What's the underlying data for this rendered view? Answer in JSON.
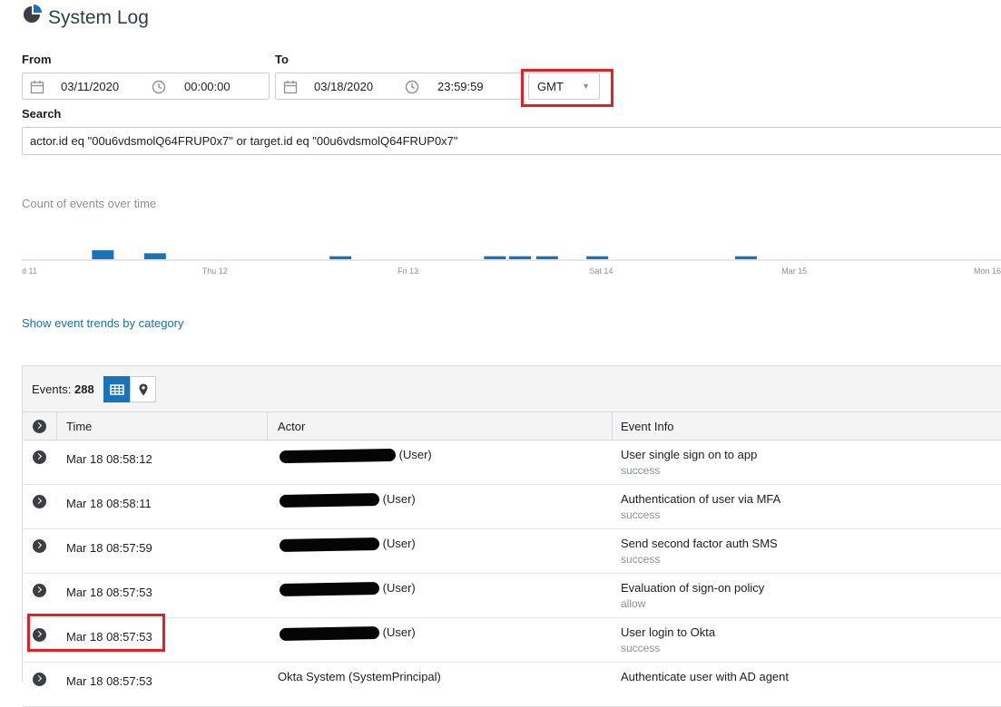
{
  "header": {
    "title": "System Log"
  },
  "filters": {
    "from_label": "From",
    "to_label": "To",
    "from_date": "03/11/2020",
    "from_time": "00:00:00",
    "to_date": "03/18/2020",
    "to_time": "23:59:59",
    "timezone": "GMT",
    "search_label": "Search",
    "search_value": "actor.id eq \"00u6vdsmolQ64FRUP0x7\" or target.id eq \"00u6vdsmolQ64FRUP0x7\""
  },
  "chart_data": {
    "type": "bar",
    "title": "Count of events over time",
    "xlabel": "",
    "ylabel": "",
    "tick_labels": [
      "d 11",
      "Thu 12",
      "Fri 13",
      "Sat 14",
      "Mar 15",
      "Mon 16"
    ],
    "x_range_days": [
      0,
      5
    ],
    "bars": [
      {
        "x": 0.42,
        "value": 3
      },
      {
        "x": 0.69,
        "value": 2
      },
      {
        "x": 1.65,
        "value": 1
      },
      {
        "x": 2.45,
        "value": 1
      },
      {
        "x": 2.58,
        "value": 1
      },
      {
        "x": 2.72,
        "value": 1
      },
      {
        "x": 2.98,
        "value": 1
      },
      {
        "x": 3.75,
        "value": 1
      }
    ],
    "grid": false,
    "bar_color": "#1a72b8"
  },
  "trends_link": "Show event trends by category",
  "table": {
    "events_label": "Events:",
    "events_count": "288",
    "columns": [
      "Time",
      "Actor",
      "Event Info"
    ],
    "rows": [
      {
        "time": "Mar 18 08:58:12",
        "actor_suffix": "(User)",
        "event": "User single sign on to app",
        "outcome": "success"
      },
      {
        "time": "Mar 18 08:58:11",
        "actor_suffix": "(User)",
        "event": "Authentication of user via MFA",
        "outcome": "success"
      },
      {
        "time": "Mar 18 08:57:59",
        "actor_suffix": "(User)",
        "event": "Send second factor auth SMS",
        "outcome": "success"
      },
      {
        "time": "Mar 18 08:57:53",
        "actor_suffix": "(User)",
        "event": "Evaluation of sign-on policy",
        "outcome": "allow"
      },
      {
        "time": "Mar 18 08:57:53",
        "actor_suffix": "(User)",
        "event": "User login to Okta",
        "outcome": "success"
      },
      {
        "time": "Mar 18 08:57:53",
        "actor_suffix": "Okta System (SystemPrincipal)",
        "event": "Authenticate user with AD agent",
        "outcome": ""
      }
    ]
  },
  "colors": {
    "accent": "#1a72b8",
    "highlight": "#e32026",
    "muted_text": "#8c9196"
  }
}
